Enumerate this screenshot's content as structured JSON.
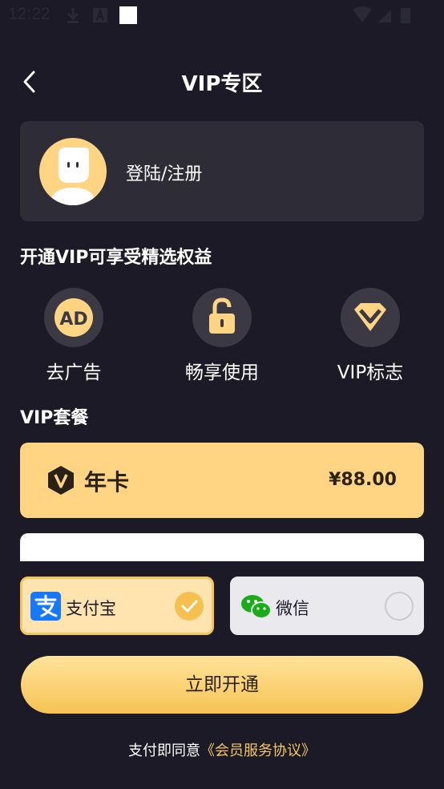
{
  "status_bar": {
    "time": "12:22"
  },
  "header": {
    "title": "VIP专区"
  },
  "profile": {
    "login_label": "登陆/注册"
  },
  "benefits": {
    "title": "开通VIP可享受精选权益",
    "items": [
      {
        "label": "去广告",
        "icon": "ad-block-icon"
      },
      {
        "label": "畅享使用",
        "icon": "unlock-icon"
      },
      {
        "label": "VIP标志",
        "icon": "vip-badge-icon"
      }
    ]
  },
  "plans": {
    "title": "VIP套餐",
    "items": [
      {
        "name": "年卡",
        "price": "¥88.00",
        "selected": true
      }
    ]
  },
  "payment": {
    "options": [
      {
        "label": "支付宝",
        "selected": true,
        "icon": "alipay-icon"
      },
      {
        "label": "微信",
        "selected": false,
        "icon": "wechat-icon"
      }
    ],
    "submit_label": "立即开通",
    "agreement_prefix": "支付即同意",
    "agreement_link": "《会员服务协议》"
  },
  "colors": {
    "background": "#1b1a26",
    "card": "#2d2c37",
    "accent_gold": "#ffd583",
    "button_gold": "#f6c354"
  }
}
